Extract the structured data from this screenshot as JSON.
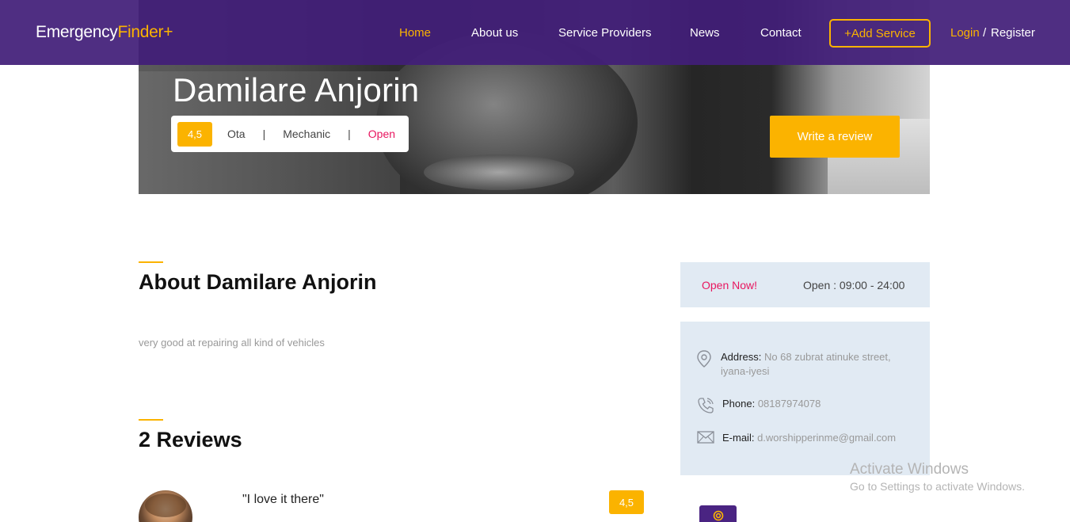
{
  "navbar": {
    "brand_main": "Emergency",
    "brand_accent": "Finder+",
    "links": [
      "Home",
      "About us",
      "Service Providers",
      "News",
      "Contact"
    ],
    "add_service": "+Add Service",
    "login": "Login",
    "slash": "/",
    "register": "Register"
  },
  "hero": {
    "name": "Damilare Anjorin",
    "rating": "4,5",
    "location": "Ota",
    "category": "Mechanic",
    "status": "Open",
    "separator": "|",
    "write_review": "Write a review"
  },
  "about": {
    "title": "About Damilare Anjorin",
    "text": "very good at repairing all kind of vehicles"
  },
  "reviews": {
    "title": "2 Reviews",
    "items": [
      {
        "quote": "\"I love it there\"",
        "rating": "4,5"
      }
    ]
  },
  "sidebar": {
    "open_now": "Open Now!",
    "hours": "Open : 09:00 - 24:00",
    "address_label": "Address:",
    "address_value": "No 68 zubrat atinuke street,",
    "address_value_2": "iyana-iyesi",
    "phone_label": "Phone:",
    "phone_value": "08187974078",
    "email_label": "E-mail:",
    "email_value": "d.worshipperinme@gmail.com"
  },
  "watermark": {
    "title": "Activate Windows",
    "subtitle": "Go to Settings to activate Windows."
  },
  "colors": {
    "navbar": "#421e78",
    "accent": "#fbb300",
    "status_open": "#e8165f",
    "panel": "#e1eaf3"
  },
  "icons": [
    "location-pin-icon",
    "phone-icon",
    "mail-icon",
    "target-icon"
  ]
}
